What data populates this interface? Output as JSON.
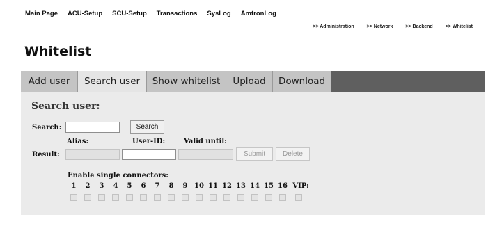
{
  "top_nav": [
    "Main Page",
    "ACU-Setup",
    "SCU-Setup",
    "Transactions",
    "SysLog",
    "AmtronLog"
  ],
  "sub_nav": [
    ">> Administration",
    ">> Network",
    ">> Backend",
    ">> Whitelist"
  ],
  "page_title": "Whitelist",
  "tabs": [
    "Add user",
    "Search user",
    "Show whitelist",
    "Upload",
    "Download"
  ],
  "active_tab": "Search user",
  "section_title": "Search user:",
  "search": {
    "label": "Search:",
    "value": "",
    "button": "Search"
  },
  "result": {
    "label": "Result:",
    "alias_label": "Alias:",
    "userid_label": "User-ID:",
    "valid_label": "Valid until:",
    "alias_value": "",
    "userid_value": "",
    "valid_value": "",
    "submit": "Submit",
    "delete": "Delete"
  },
  "connectors": {
    "label": "Enable single connectors:",
    "numbers": [
      "1",
      "2",
      "3",
      "4",
      "5",
      "6",
      "7",
      "8",
      "9",
      "10",
      "11",
      "12",
      "13",
      "14",
      "15",
      "16",
      "VIP:"
    ]
  },
  "colors": {
    "tab_bar": "#5f5f5f",
    "tab": "#c4c4c4",
    "tab_active": "#e5e5e5",
    "panel": "#ebebeb"
  }
}
